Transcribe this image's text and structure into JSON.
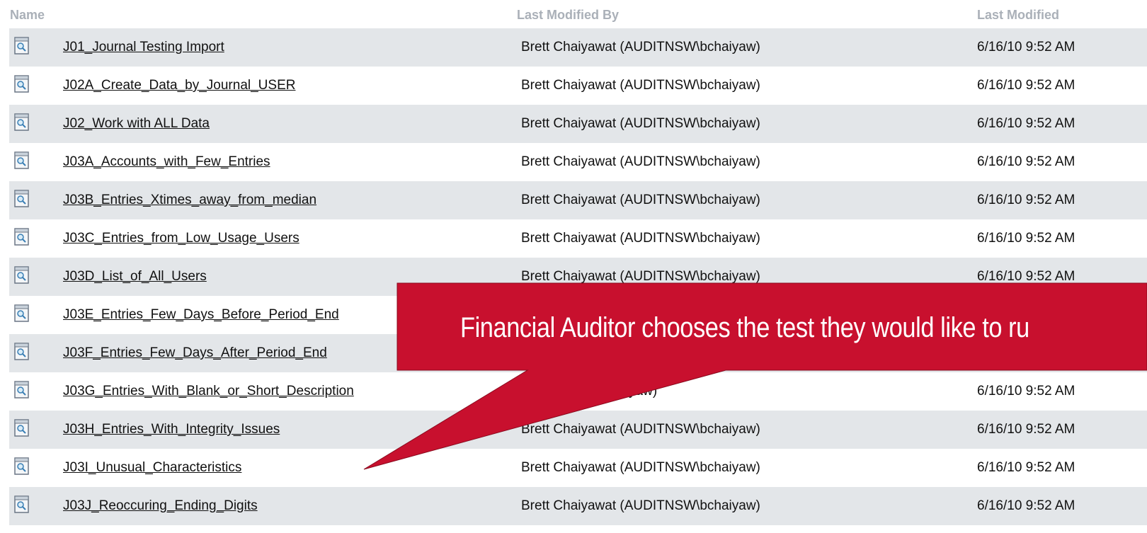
{
  "header": {
    "name": "Name",
    "modified_by": "Last Modified By",
    "last_modified": "Last Modified"
  },
  "rows": [
    {
      "name": "J01_Journal Testing Import",
      "by": "Brett Chaiyawat (AUDITNSW\\bchaiyaw)",
      "modified": "6/16/10 9:52 AM"
    },
    {
      "name": "J02A_Create_Data_by_Journal_USER",
      "by": "Brett Chaiyawat (AUDITNSW\\bchaiyaw)",
      "modified": "6/16/10 9:52 AM"
    },
    {
      "name": "J02_Work with ALL Data",
      "by": "Brett Chaiyawat (AUDITNSW\\bchaiyaw)",
      "modified": "6/16/10 9:52 AM"
    },
    {
      "name": "J03A_Accounts_with_Few_Entries",
      "by": "Brett Chaiyawat (AUDITNSW\\bchaiyaw)",
      "modified": "6/16/10 9:52 AM"
    },
    {
      "name": "J03B_Entries_Xtimes_away_from_median",
      "by": "Brett Chaiyawat (AUDITNSW\\bchaiyaw)",
      "modified": "6/16/10 9:52 AM"
    },
    {
      "name": "J03C_Entries_from_Low_Usage_Users",
      "by": "Brett Chaiyawat (AUDITNSW\\bchaiyaw)",
      "modified": "6/16/10 9:52 AM"
    },
    {
      "name": "J03D_List_of_All_Users",
      "by": "Brett Chaiyawat (AUDITNSW\\bchaiyaw)",
      "modified": "6/16/10 9:52 AM"
    },
    {
      "name": "J03E_Entries_Few_Days_Before_Period_End",
      "by": "",
      "modified": ""
    },
    {
      "name": "J03F_Entries_Few_Days_After_Period_End",
      "by": "",
      "modified": ""
    },
    {
      "name": "J03G_Entries_With_Blank_or_Short_Description",
      "by": "AUDITNSW\\bchaiyaw)",
      "modified": "6/16/10 9:52 AM"
    },
    {
      "name": "J03H_Entries_With_Integrity_Issues",
      "by": "Brett Chaiyawat (AUDITNSW\\bchaiyaw)",
      "modified": "6/16/10 9:52 AM"
    },
    {
      "name": "J03I_Unusual_Characteristics",
      "by": "Brett Chaiyawat (AUDITNSW\\bchaiyaw)",
      "modified": "6/16/10 9:52 AM"
    },
    {
      "name": "J03J_Reoccuring_Ending_Digits",
      "by": "Brett Chaiyawat (AUDITNSW\\bchaiyaw)",
      "modified": "6/16/10 9:52 AM"
    }
  ],
  "callout": {
    "text": "Financial Auditor chooses the test they would like to ru",
    "color": "#c8102e"
  },
  "icons": {
    "row_icon": "report-document-icon"
  }
}
